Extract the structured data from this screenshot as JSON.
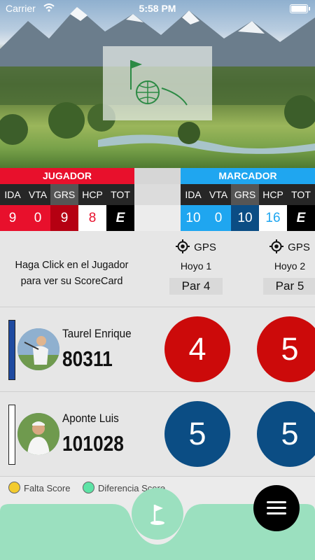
{
  "status_bar": {
    "carrier": "Carrier",
    "time": "5:58 PM"
  },
  "header": {
    "jugador_label": "JUGADOR",
    "marcador_label": "MARCADOR",
    "columns": [
      "IDA",
      "VTA",
      "GRS",
      "HCP",
      "TOT"
    ],
    "jugador_values": [
      "9",
      "0",
      "9",
      "8",
      "E"
    ],
    "marcador_values": [
      "10",
      "0",
      "10",
      "16",
      "E"
    ]
  },
  "info": {
    "instruction_line1": "Haga Click en el Jugador",
    "instruction_line2": "para ver su ScoreCard",
    "holes": [
      {
        "gps_label": "GPS",
        "hole_label": "Hoyo 1",
        "par_label": "Par 4"
      },
      {
        "gps_label": "GPS",
        "hole_label": "Hoyo 2",
        "par_label": "Par 5"
      }
    ]
  },
  "players": [
    {
      "name": "Taurel Enrique",
      "number": "80311",
      "scores": [
        "4",
        "5"
      ],
      "bar_color": "#1f4aa0",
      "score_color": "#cc0a0a"
    },
    {
      "name": "Aponte Luis",
      "number": "101028",
      "scores": [
        "5",
        "5"
      ],
      "bar_color": "#ffffff",
      "score_color": "#0b4d84"
    }
  ],
  "legend": {
    "falta_score": "Falta Score",
    "diferencia_score": "Diferencia Score",
    "falta_color": "#f3cb2e",
    "diferencia_color": "#5ee3a6"
  },
  "colors": {
    "jugador_red": "#e8102c",
    "jugador_dark_red": "#b50012",
    "marcador_blue": "#1fa6f0",
    "marcador_dark_blue": "#0b4d84",
    "bottom_bar_green": "#9be0bf"
  },
  "icons": {
    "gps": "crosshair-icon",
    "flag": "golf-flag-icon",
    "menu": "hamburger-menu-icon"
  }
}
